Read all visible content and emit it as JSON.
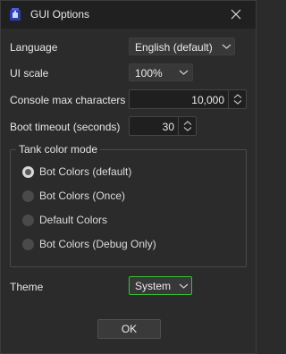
{
  "window": {
    "title": "GUI Options",
    "app_icon": "tank-app-icon",
    "close_icon": "close-icon"
  },
  "fields": {
    "language": {
      "label": "Language",
      "value": "English (default)"
    },
    "ui_scale": {
      "label": "UI scale",
      "value": "100%"
    },
    "console_max_chars": {
      "label": "Console max characters",
      "value": "10,000"
    },
    "boot_timeout": {
      "label": "Boot timeout (seconds)",
      "value": "30"
    }
  },
  "tank_color_mode": {
    "title": "Tank color mode",
    "options": [
      {
        "label": "Bot Colors (default)",
        "checked": true
      },
      {
        "label": "Bot Colors (Once)",
        "checked": false
      },
      {
        "label": "Default Colors",
        "checked": false
      },
      {
        "label": "Bot Colors (Debug Only)",
        "checked": false
      }
    ]
  },
  "theme": {
    "label": "Theme",
    "value": "System",
    "focus_color": "#35c235"
  },
  "ok_button": {
    "label": "OK"
  },
  "colors": {
    "background": "#2b2b2b",
    "titlebar": "#202020",
    "focus": "#35c235"
  }
}
